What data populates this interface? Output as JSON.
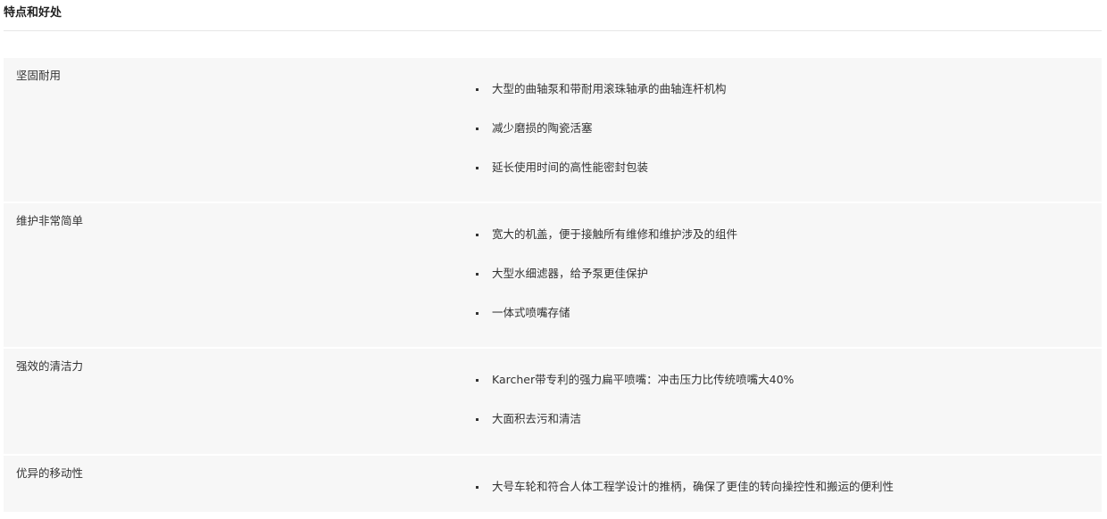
{
  "section": {
    "title": "特点和好处"
  },
  "features": [
    {
      "name": "坚固耐用",
      "items": [
        "大型的曲轴泵和带耐用滚珠轴承的曲轴连杆机构",
        "减少磨损的陶瓷活塞",
        "延长使用时间的高性能密封包装"
      ]
    },
    {
      "name": "维护非常简单",
      "items": [
        "宽大的机盖，便于接触所有维修和维护涉及的组件",
        "大型水细滤器，给予泵更佳保护",
        "一体式喷嘴存储"
      ]
    },
    {
      "name": "强效的清洁力",
      "items": [
        "Karcher带专利的强力扁平喷嘴：冲击压力比传统喷嘴大40%",
        "大面积去污和清洁"
      ]
    },
    {
      "name": "优异的移动性",
      "items": [
        "大号车轮和符合人体工程学设计的推柄，确保了更佳的转向操控性和搬运的便利性"
      ]
    }
  ]
}
